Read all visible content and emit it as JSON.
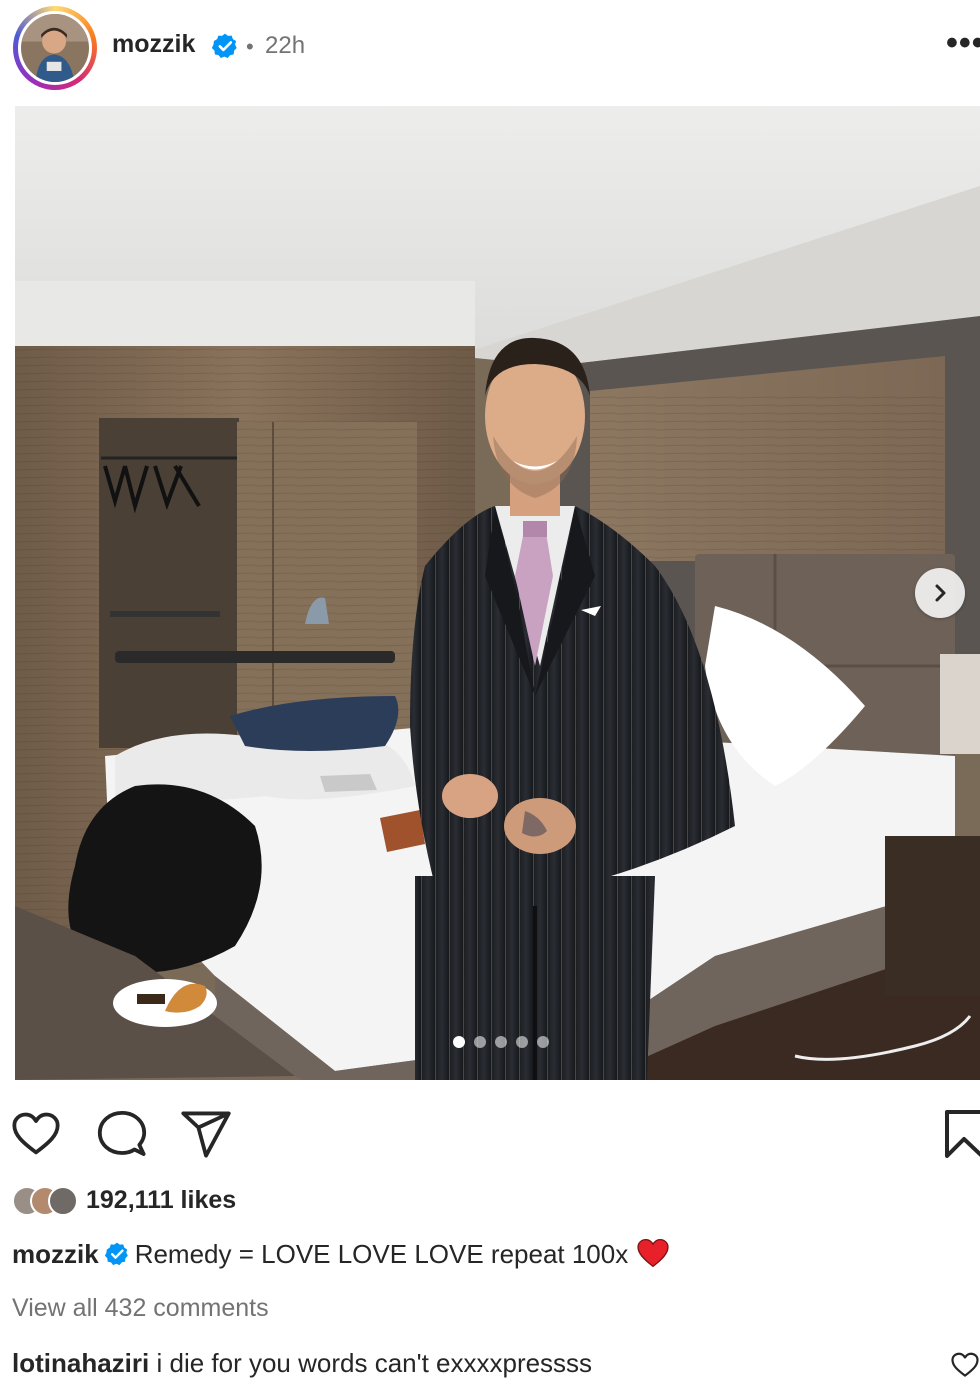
{
  "post": {
    "username": "mozzik",
    "separator": "•",
    "time_ago": "22h",
    "more_label": "•••",
    "carousel": {
      "total": 5,
      "active": 1
    }
  },
  "icons": {
    "verified": "verified-badge-icon",
    "more": "more-options-icon",
    "next": "chevron-right-icon",
    "like": "heart-outline-icon",
    "comment": "comment-bubble-icon",
    "share": "paper-plane-icon",
    "save": "bookmark-icon"
  },
  "engagement": {
    "likes_text": "192,111 likes"
  },
  "caption": {
    "username": "mozzik",
    "text": "Remedy = LOVE LOVE LOVE repeat 100x"
  },
  "comments": {
    "view_all": "View all 432 comments",
    "items": [
      {
        "username": "lotinahaziri",
        "text": "i die for you words can't exxxxpressss"
      }
    ]
  },
  "colors": {
    "verified": "#0095f6",
    "muted_text": "#737373",
    "primary_text": "#262626",
    "heart_red": "#e8202a"
  }
}
